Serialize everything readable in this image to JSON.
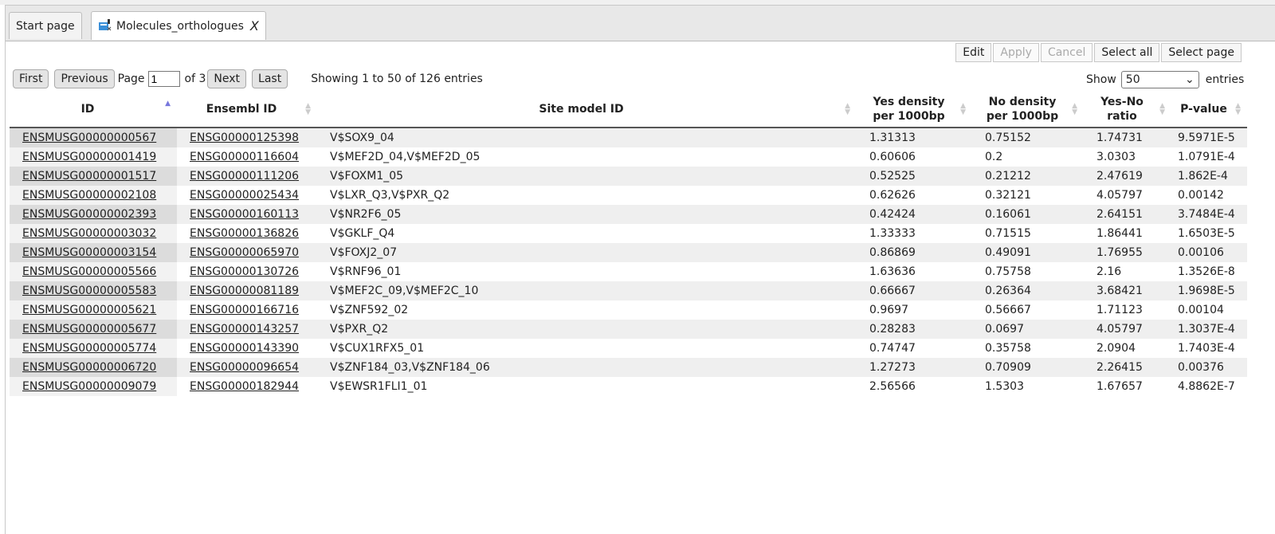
{
  "tabs": [
    {
      "label": "Start page"
    },
    {
      "label": "Molecules_orthologues",
      "close": "X"
    }
  ],
  "actions": {
    "edit": "Edit",
    "apply": "Apply",
    "cancel": "Cancel",
    "select_all": "Select all",
    "select_page": "Select page"
  },
  "pager": {
    "first": "First",
    "previous": "Previous",
    "page_label": "Page",
    "page": "1",
    "of": "of 3",
    "next": "Next",
    "last": "Last",
    "showing": "Showing 1 to 50 of 126 entries"
  },
  "length": {
    "show": "Show",
    "value": "50",
    "entries": "entries"
  },
  "columns": [
    "ID",
    "Ensembl ID",
    "Site model ID",
    "Yes density per 1000bp",
    "No density per 1000bp",
    "Yes-No ratio",
    "P-value"
  ],
  "rows": [
    [
      "ENSMUSG00000000567",
      "ENSG00000125398",
      "V$SOX9_04",
      "1.31313",
      "0.75152",
      "1.74731",
      "9.5971E-5"
    ],
    [
      "ENSMUSG00000001419",
      "ENSG00000116604",
      "V$MEF2D_04,V$MEF2D_05",
      "0.60606",
      "0.2",
      "3.0303",
      "1.0791E-4"
    ],
    [
      "ENSMUSG00000001517",
      "ENSG00000111206",
      "V$FOXM1_05",
      "0.52525",
      "0.21212",
      "2.47619",
      "1.862E-4"
    ],
    [
      "ENSMUSG00000002108",
      "ENSG00000025434",
      "V$LXR_Q3,V$PXR_Q2",
      "0.62626",
      "0.32121",
      "4.05797",
      "0.00142"
    ],
    [
      "ENSMUSG00000002393",
      "ENSG00000160113",
      "V$NR2F6_05",
      "0.42424",
      "0.16061",
      "2.64151",
      "3.7484E-4"
    ],
    [
      "ENSMUSG00000003032",
      "ENSG00000136826",
      "V$GKLF_Q4",
      "1.33333",
      "0.71515",
      "1.86441",
      "1.6503E-5"
    ],
    [
      "ENSMUSG00000003154",
      "ENSG00000065970",
      "V$FOXJ2_07",
      "0.86869",
      "0.49091",
      "1.76955",
      "0.00106"
    ],
    [
      "ENSMUSG00000005566",
      "ENSG00000130726",
      "V$RNF96_01",
      "1.63636",
      "0.75758",
      "2.16",
      "1.3526E-8"
    ],
    [
      "ENSMUSG00000005583",
      "ENSG00000081189",
      "V$MEF2C_09,V$MEF2C_10",
      "0.66667",
      "0.26364",
      "3.68421",
      "1.9698E-5"
    ],
    [
      "ENSMUSG00000005621",
      "ENSG00000166716",
      "V$ZNF592_02",
      "0.9697",
      "0.56667",
      "1.71123",
      "0.00104"
    ],
    [
      "ENSMUSG00000005677",
      "ENSG00000143257",
      "V$PXR_Q2",
      "0.28283",
      "0.0697",
      "4.05797",
      "1.3037E-4"
    ],
    [
      "ENSMUSG00000005774",
      "ENSG00000143390",
      "V$CUX1RFX5_01",
      "0.74747",
      "0.35758",
      "2.0904",
      "1.7403E-4"
    ],
    [
      "ENSMUSG00000006720",
      "ENSG00000096654",
      "V$ZNF184_03,V$ZNF184_06",
      "1.27273",
      "0.70909",
      "2.26415",
      "0.00376"
    ],
    [
      "ENSMUSG00000009079",
      "ENSG00000182944",
      "V$EWSR1FLI1_01",
      "2.56566",
      "1.5303",
      "1.67657",
      "4.8862E-7"
    ]
  ]
}
